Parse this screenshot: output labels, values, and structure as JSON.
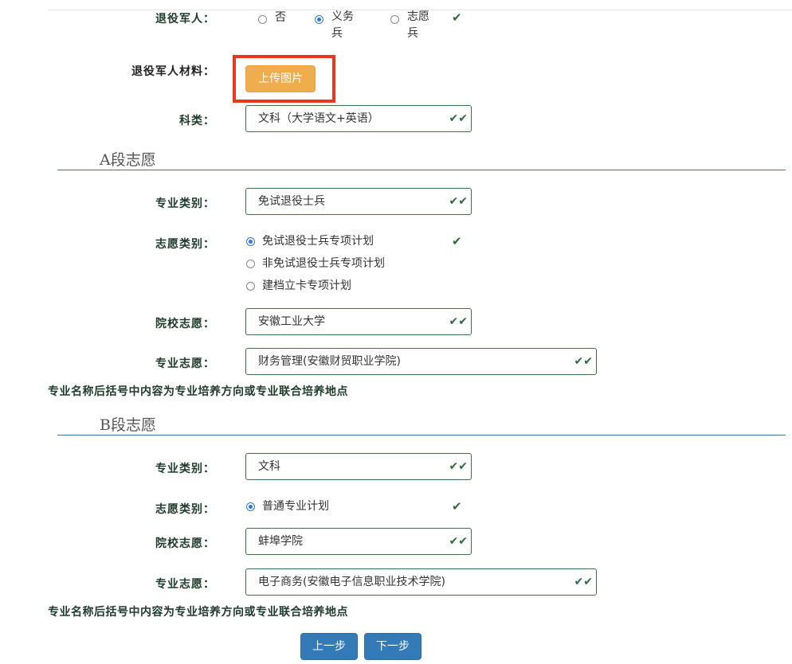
{
  "veteran": {
    "label": "退役军人：",
    "options": [
      {
        "text": "否",
        "selected": false
      },
      {
        "text": "义务兵",
        "selected": true
      },
      {
        "text": "志愿兵",
        "selected": false
      }
    ],
    "check": "✔"
  },
  "materials": {
    "label": "退役军人材料：",
    "upload_label": "上传图片"
  },
  "subject": {
    "label": "科类：",
    "value": "文科（大学语文+英语）"
  },
  "section_a": {
    "title": "A段志愿",
    "major_category_label": "专业类别：",
    "major_category_value": "免试退役士兵",
    "plan_type_label": "志愿类别：",
    "plan_options": [
      {
        "text": "免试退役士兵专项计划",
        "selected": true
      },
      {
        "text": "非免试退役士兵专项计划",
        "selected": false
      },
      {
        "text": "建档立卡专项计划",
        "selected": false
      }
    ],
    "school_label": "院校志愿：",
    "school_value": "安徽工业大学",
    "major_label": "专业志愿：",
    "major_value": "财务管理(安徽财贸职业学院)",
    "note": "专业名称后括号中内容为专业培养方向或专业联合培养地点"
  },
  "section_b": {
    "title": "B段志愿",
    "major_category_label": "专业类别：",
    "major_category_value": "文科",
    "plan_type_label": "志愿类别：",
    "plan_options": [
      {
        "text": "普通专业计划",
        "selected": true
      }
    ],
    "school_label": "院校志愿：",
    "school_value": "蚌埠学院",
    "major_label": "专业志愿：",
    "major_value": "电子商务(安徽电子信息职业技术学院)",
    "note": "专业名称后括号中内容为专业培养方向或专业联合培养地点"
  },
  "nav": {
    "prev_label": "上一步",
    "next_label": "下一步"
  },
  "icons": {
    "check": "check-icon",
    "double_check": "double-check-icon"
  },
  "colors": {
    "label_green": "#1f3b2b",
    "field_border": "#3e6f47",
    "check_green": "#2e6b3a",
    "upload_orange": "#f0ad4e",
    "highlight_red": "#e8391e",
    "primary_blue": "#337ab7",
    "section_rule": "#3f7896"
  }
}
